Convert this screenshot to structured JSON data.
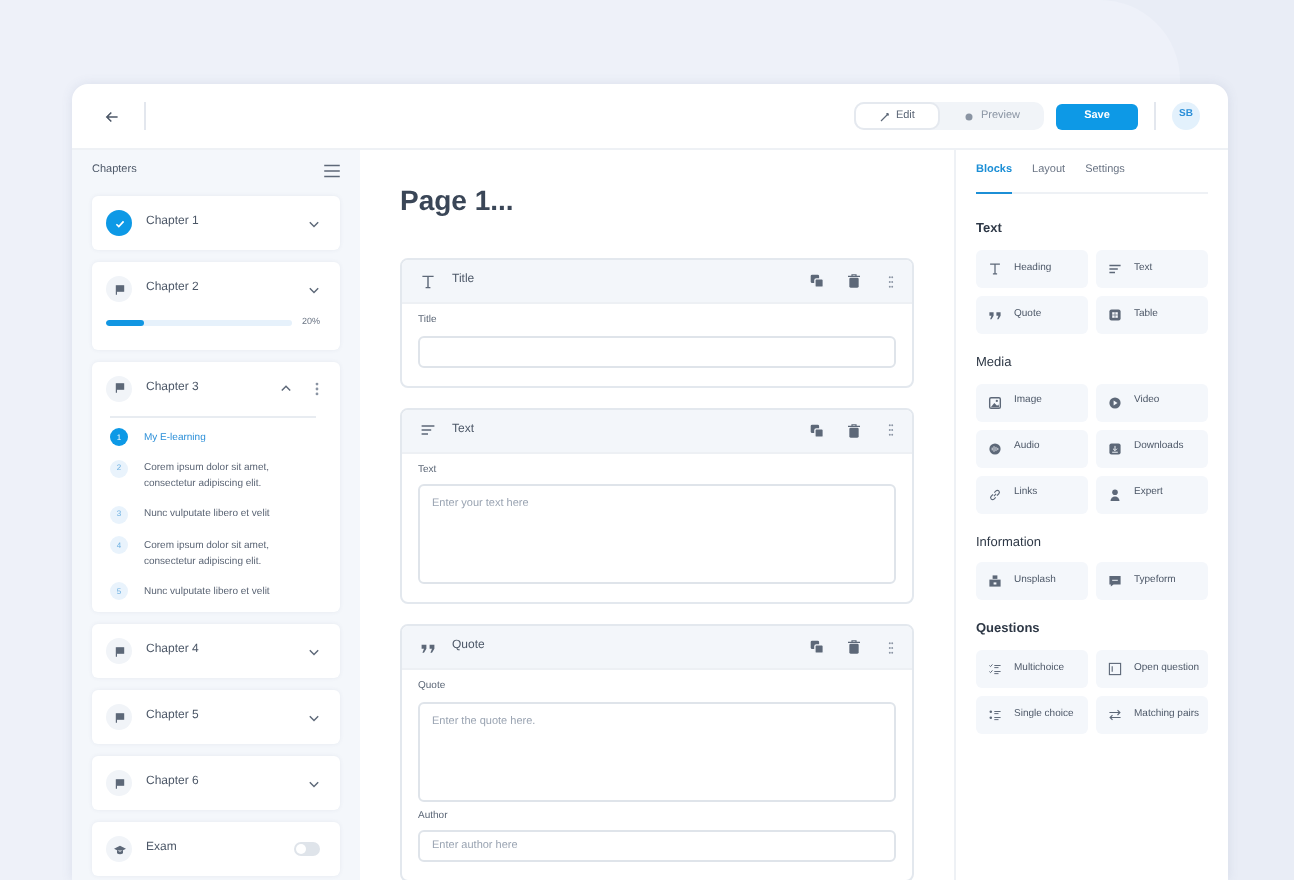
{
  "toolbar": {
    "edit": "Edit",
    "preview": "Preview",
    "save": "Save",
    "avatar": "SB"
  },
  "sidebar": {
    "title": "Chapters",
    "chapters": [
      {
        "label": "Chapter 1",
        "completed": true,
        "expanded": false
      },
      {
        "label": "Chapter 2",
        "completed": false,
        "expanded": false,
        "progress": {
          "level": 0.2,
          "reading": "20%"
        }
      },
      {
        "label": "Chapter 3",
        "completed": false,
        "expanded": true,
        "lessons": [
          {
            "number": "1",
            "label": "My E-learning",
            "selected": true
          },
          {
            "number": "2",
            "label": "Corem ipsum dolor sit amet, consectetur adipiscing elit.",
            "selected": false
          },
          {
            "number": "3",
            "label": "Nunc vulputate libero et velit",
            "selected": false
          },
          {
            "number": "4",
            "label": "Corem ipsum dolor sit amet, consectetur adipiscing elit.",
            "selected": false
          },
          {
            "number": "5",
            "label": "Nunc vulputate libero et velit",
            "selected": false
          }
        ]
      },
      {
        "label": "Chapter 4",
        "completed": false,
        "expanded": false
      },
      {
        "label": "Chapter 5",
        "completed": false,
        "expanded": false
      },
      {
        "label": "Chapter 6",
        "completed": false,
        "expanded": false
      }
    ],
    "exam": {
      "label": "Exam",
      "on": false
    }
  },
  "page": {
    "title": "Page 1...",
    "blocks": [
      {
        "kind": "title",
        "title": "Title",
        "fields": [
          {
            "kind": "input",
            "label": "Title"
          }
        ]
      },
      {
        "kind": "text",
        "title": "Text",
        "fields": [
          {
            "kind": "textarea",
            "label": "Text",
            "placeholder": "Enter your text here"
          }
        ]
      },
      {
        "kind": "quote",
        "title": "Quote",
        "fields": [
          {
            "kind": "textarea",
            "label": "Quote",
            "placeholder": "Enter the quote here."
          },
          {
            "kind": "input",
            "label": "Author",
            "placeholder": "Enter author here"
          }
        ]
      }
    ]
  },
  "panel": {
    "tabs": [
      {
        "label": "Blocks",
        "selected": true
      },
      {
        "label": "Layout",
        "selected": false
      },
      {
        "label": "Settings",
        "selected": false
      }
    ],
    "sections": [
      {
        "title": "Text",
        "items": [
          {
            "kind": "heading",
            "label": "Heading"
          },
          {
            "kind": "text",
            "label": "Text"
          },
          {
            "kind": "quote",
            "label": "Quote"
          },
          {
            "kind": "table",
            "label": "Table"
          }
        ]
      },
      {
        "title": "Media",
        "items": [
          {
            "kind": "image",
            "label": "Image"
          },
          {
            "kind": "video",
            "label": "Video"
          },
          {
            "kind": "audio",
            "label": "Audio"
          },
          {
            "kind": "downloads",
            "label": "Downloads"
          },
          {
            "kind": "link",
            "label": "Links"
          },
          {
            "kind": "person",
            "label": "Expert"
          }
        ]
      },
      {
        "title": "Information",
        "items": [
          {
            "kind": "camera",
            "label": "Unsplash"
          },
          {
            "kind": "chat",
            "label": "Typeform"
          }
        ]
      },
      {
        "title": "Questions",
        "items": [
          {
            "kind": "checklist",
            "label": "Multichoice"
          },
          {
            "kind": "textbox",
            "label": "Open question"
          },
          {
            "kind": "radiolist",
            "label": "Single choice"
          },
          {
            "kind": "swap",
            "label": "Matching pairs"
          }
        ]
      }
    ]
  }
}
